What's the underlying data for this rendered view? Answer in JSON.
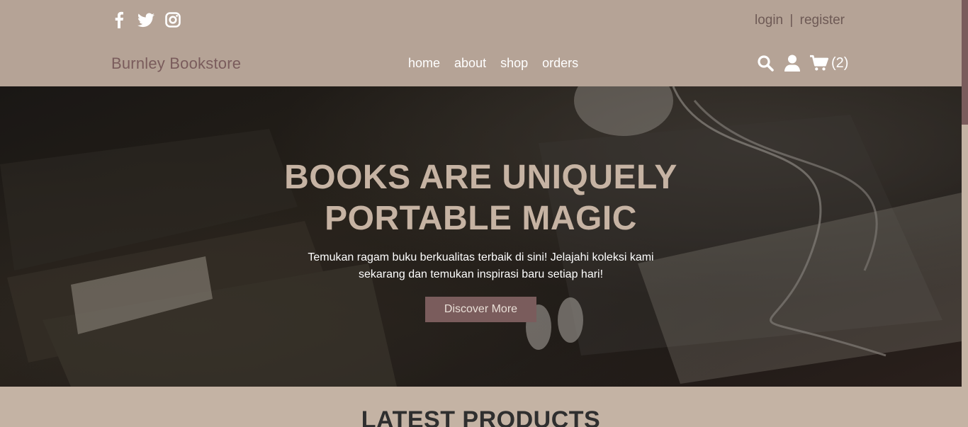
{
  "social": {
    "icons": [
      "facebook-icon",
      "twitter-icon",
      "instagram-icon"
    ]
  },
  "auth": {
    "login": "login",
    "separator": "|",
    "register": "register"
  },
  "header": {
    "brand": "Burnley Bookstore",
    "nav": [
      "home",
      "about",
      "shop",
      "orders"
    ],
    "cart_count": "(2)"
  },
  "hero": {
    "title_line1": "BOOKS ARE UNIQUELY",
    "title_line2": "PORTABLE MAGIC",
    "subtitle": "Temukan ragam buku berkualitas terbaik di sini! Jelajahi koleksi kami sekarang dan temukan inspirasi baru setiap hari!",
    "button": "Discover More"
  },
  "section": {
    "title": "LATEST PRODUCTS"
  },
  "colors": {
    "header_bg": "#b5a396",
    "page_bg": "#c4b3a4",
    "accent": "#7a5c5c",
    "hero_title": "#c6b3a3"
  }
}
